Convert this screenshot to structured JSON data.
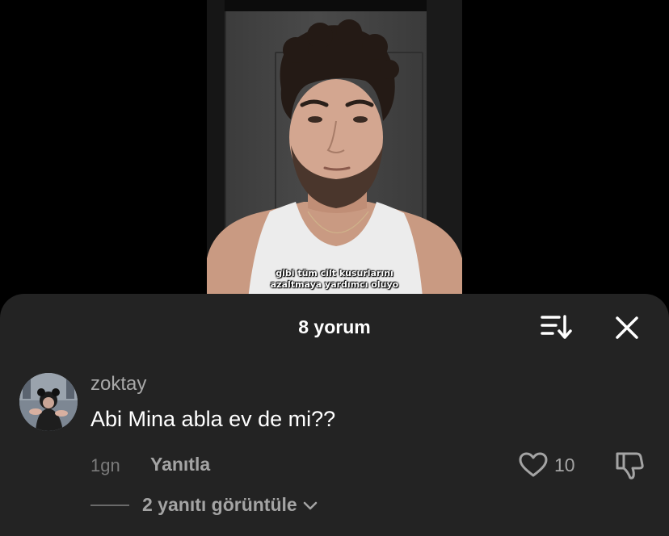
{
  "video": {
    "caption_line1": "gibi tüm cilt kusurlarını",
    "caption_line2": "azaltmaya yardımcı oluyo"
  },
  "comments_sheet": {
    "title": "8 yorum",
    "sort_icon": "sort-descending-icon",
    "close_icon": "close-icon"
  },
  "comment": {
    "username": "zoktay",
    "text": "Abi Mina abla ev de mi??",
    "time": "1gn",
    "reply_label": "Yanıtla",
    "like_count": "10",
    "like_icon": "heart-outline-icon",
    "dislike_icon": "thumbs-down-icon",
    "view_replies_label": "2 yanıtı görüntüle"
  },
  "colors": {
    "sheet_background": "#232323",
    "muted_text": "#a4a4a4"
  }
}
